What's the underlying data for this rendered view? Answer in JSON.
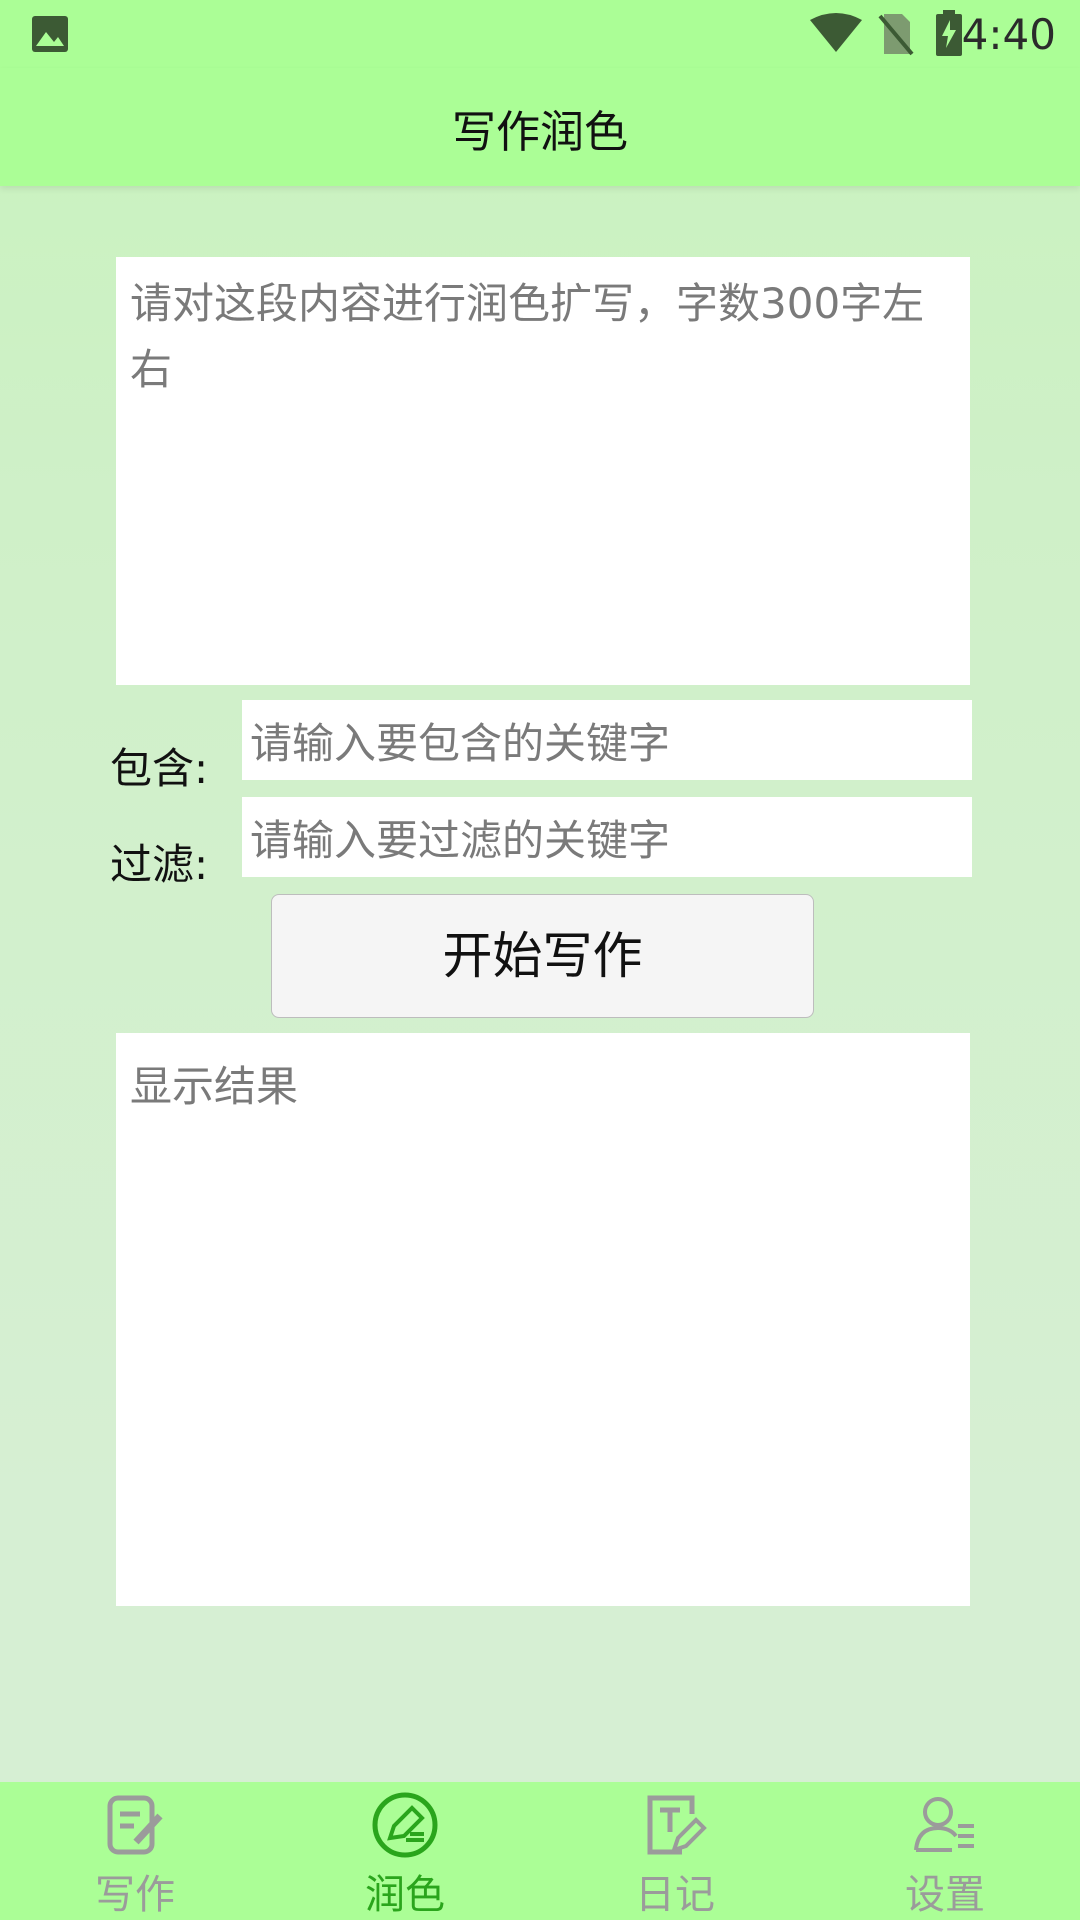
{
  "status_bar": {
    "time": "4:40",
    "icons": [
      "image-icon",
      "wifi-icon",
      "no-sim-icon",
      "battery-charging-icon"
    ]
  },
  "header": {
    "title": "写作润色"
  },
  "form": {
    "prompt_text": "请对这段内容进行润色扩写，字数300字左右",
    "include_label": "包含:",
    "include_placeholder": "请输入要包含的关键字",
    "filter_label": "过滤:",
    "filter_placeholder": "请输入要过滤的关键字",
    "start_button": "开始写作",
    "result_placeholder": "显示结果"
  },
  "bottom_nav": {
    "items": [
      {
        "label": "写作",
        "icon": "write-doc-icon",
        "active": false
      },
      {
        "label": "润色",
        "icon": "polish-pen-icon",
        "active": true
      },
      {
        "label": "日记",
        "icon": "diary-edit-icon",
        "active": false
      },
      {
        "label": "设置",
        "icon": "user-settings-icon",
        "active": false
      }
    ]
  },
  "colors": {
    "bar_green": "#abfe96",
    "active_green": "#2aa51c",
    "inactive_gray": "#9b9b9b"
  }
}
